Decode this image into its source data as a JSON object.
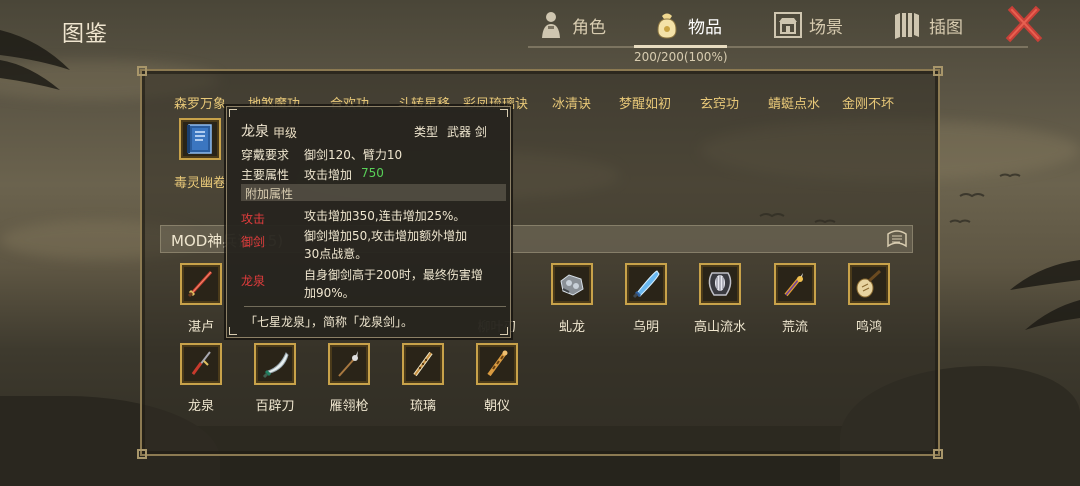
{
  "header": {
    "title": "图鉴",
    "tabs": [
      {
        "label": "角色",
        "icon": "character-icon"
      },
      {
        "label": "物品",
        "icon": "item-bag-icon",
        "active": true
      },
      {
        "label": "场景",
        "icon": "scene-icon"
      },
      {
        "label": "插图",
        "icon": "illustration-icon"
      }
    ],
    "progress": "200/200(100%)",
    "close_icon": "close-x-icon"
  },
  "skill_names": [
    "森罗万象",
    "地煞魔功",
    "合欢功",
    "斗转星移",
    "彩凤琉璃诀",
    "冰清诀",
    "梦醒如初",
    "玄窍功",
    "蜻蜓点水",
    "金刚不坏"
  ],
  "book": {
    "label": "毒灵幽卷",
    "icon": "book-icon"
  },
  "section": {
    "title": "MOD神兵谱(15)"
  },
  "weapons_row1": [
    {
      "label": "湛卢",
      "icon": "red-sword-icon"
    },
    {
      "label": "",
      "icon": "hidden-icon"
    },
    {
      "label": "",
      "icon": "hidden-icon"
    },
    {
      "label": "",
      "icon": "hidden-icon"
    },
    {
      "label": "柳叶刃",
      "icon": "hidden-icon"
    },
    {
      "label": "虬龙",
      "icon": "gauntlet-icon"
    },
    {
      "label": "乌明",
      "icon": "blue-blade-icon"
    },
    {
      "label": "高山流水",
      "icon": "harp-icon"
    },
    {
      "label": "荒流",
      "icon": "golden-spear-icon"
    },
    {
      "label": "鸣鸿",
      "icon": "pipa-icon"
    }
  ],
  "weapons_row2": [
    {
      "label": "龙泉",
      "icon": "red-sword-icon"
    },
    {
      "label": "百辟刀",
      "icon": "sabre-icon"
    },
    {
      "label": "雁翎枪",
      "icon": "spear-icon"
    },
    {
      "label": "琉璃",
      "icon": "flute-icon"
    },
    {
      "label": "朝仪",
      "icon": "staff-icon"
    }
  ],
  "tooltip": {
    "name": "龙泉",
    "grade": "甲级",
    "type_label": "类型",
    "type_value": "武器 剑",
    "req_label": "穿戴要求",
    "req_value": "御剑120、臂力10",
    "main_label": "主要属性",
    "main_value": "攻击增加",
    "main_number": "750",
    "extra_header": "附加属性",
    "attrs": [
      {
        "key": "攻击",
        "line1": "攻击增加350,连击增加25%。",
        "line2": ""
      },
      {
        "key": "御剑",
        "line1": "御剑增加50,攻击增加额外增加",
        "line2": "30点战意。"
      },
      {
        "key": "龙泉",
        "line1": "自身御剑高于200时，最终伤害增",
        "line2": "加90%。"
      }
    ],
    "flavor": "「七星龙泉」，简称「龙泉剑」。"
  },
  "colors": {
    "accent_gold": "#c8a24a",
    "label_gold": "#e8c878",
    "attr_red": "#e03c3c",
    "value_green": "#58d058"
  }
}
